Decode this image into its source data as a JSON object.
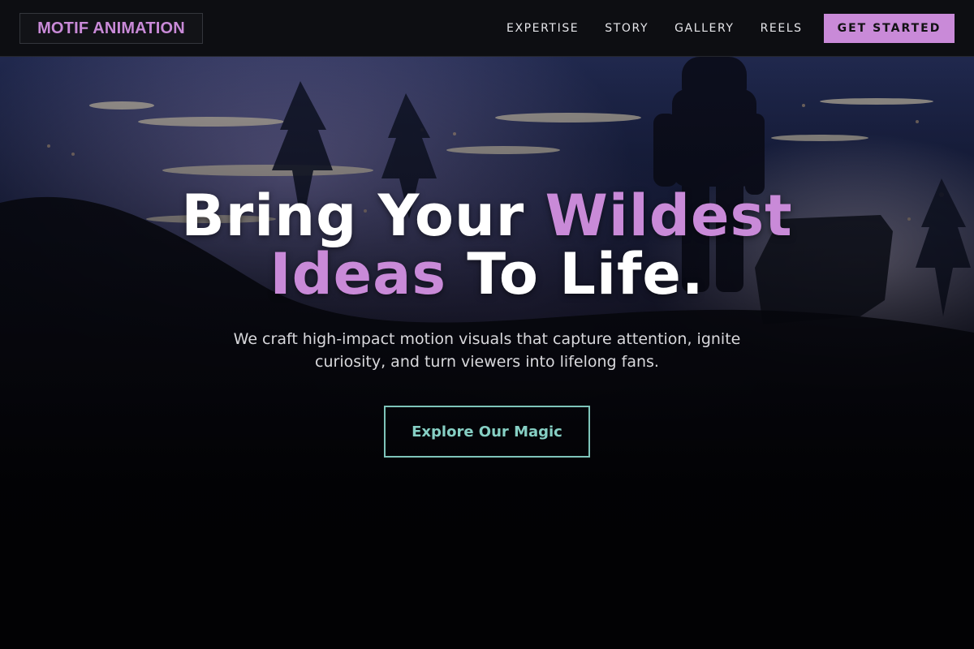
{
  "brand": {
    "name": "MOTIF ANIMATION"
  },
  "nav": {
    "links": [
      {
        "label": "EXPERTISE"
      },
      {
        "label": "STORY"
      },
      {
        "label": "GALLERY"
      },
      {
        "label": "REELS"
      }
    ],
    "cta_label": "GET STARTED"
  },
  "hero": {
    "headline_part1": "Bring Your ",
    "headline_accent1": "Wildest",
    "headline_accent2": "Ideas",
    "headline_part2": " To Life.",
    "subtext": "We craft high-impact motion visuals that capture attention, ignite curiosity, and turn viewers into lifelong fans.",
    "cta_label": "Explore Our Magic",
    "background_image": "night-city-lights-astronaut"
  },
  "colors": {
    "accent": "#c98ad8",
    "teal": "#7ec4ba",
    "nav_bg": "#0d0e12",
    "page_bg": "#050507"
  }
}
